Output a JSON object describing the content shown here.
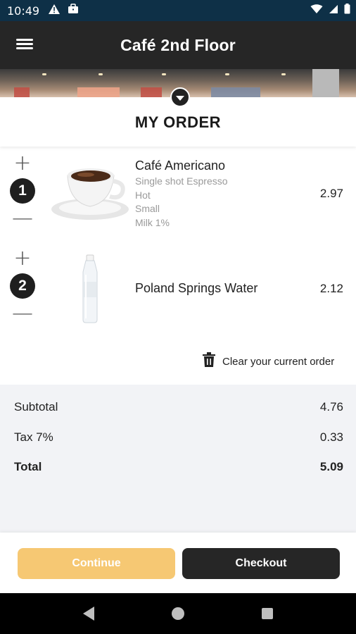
{
  "status_bar": {
    "time": "10:49",
    "icons": [
      "warning-icon",
      "briefcase-icon",
      "wifi-icon",
      "signal-icon",
      "battery-icon"
    ]
  },
  "header": {
    "title": "Café 2nd Floor",
    "menu_icon": "hamburger-menu-icon"
  },
  "order": {
    "heading": "MY ORDER",
    "items": [
      {
        "quantity": "1",
        "name": "Café Americano",
        "options": [
          "Single shot Espresso",
          "Hot",
          "Small",
          "Milk 1%"
        ],
        "price": "2.97",
        "image": "coffee-cup-image"
      },
      {
        "quantity": "2",
        "name": "Poland Springs Water",
        "options": [],
        "price": "2.12",
        "image": "water-bottle-image"
      }
    ],
    "plus_symbol": "+",
    "minus_symbol": "—",
    "clear_label": "Clear your current order"
  },
  "summary": {
    "subtotal_label": "Subtotal",
    "subtotal": "4.76",
    "tax_label": "Tax 7%",
    "tax": "0.33",
    "total_label": "Total",
    "total": "5.09"
  },
  "actions": {
    "continue_label": "Continue",
    "checkout_label": "Checkout"
  },
  "colors": {
    "status_bar": "#0e3047",
    "top_bar": "#262626",
    "continue_button": "#f6c873",
    "checkout_button": "#262626",
    "summary_bg": "#f2f3f6"
  }
}
